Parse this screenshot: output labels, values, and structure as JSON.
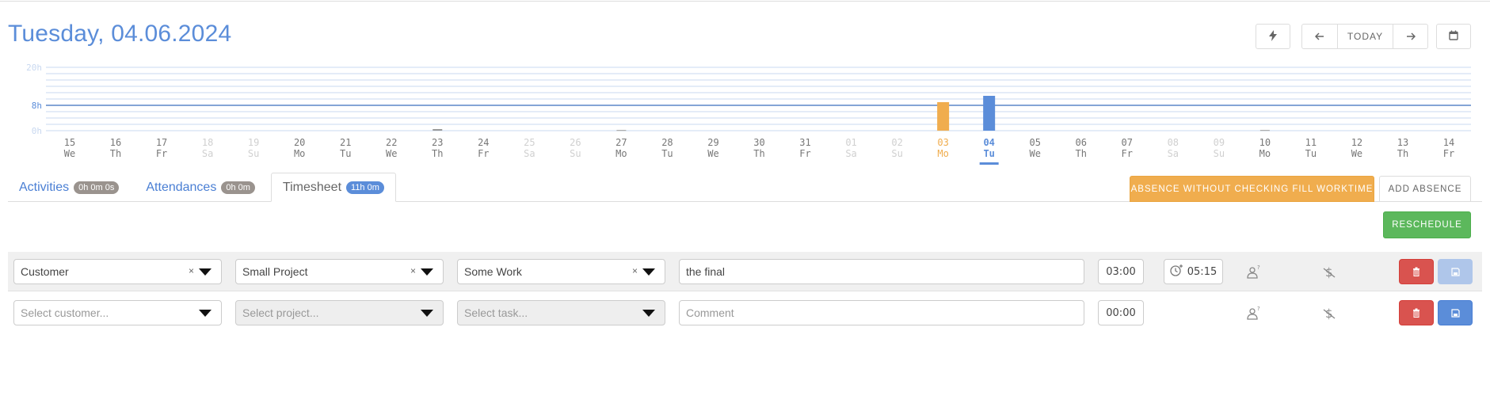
{
  "header": {
    "title": "Tuesday, 04.06.2024",
    "buttons": {
      "quick_icon": "bolt-icon",
      "prev_icon": "arrow-left-icon",
      "today_label": "TODAY",
      "next_icon": "arrow-right-icon",
      "calendar_icon": "calendar-icon"
    }
  },
  "colors": {
    "accent": "#5b8dd9",
    "warning": "#f0ad4e",
    "success": "#5cb85c",
    "danger": "#d9534f",
    "weekend_text": "#d0d0d0",
    "weekday_text": "#777777",
    "grid": "#c9daf0",
    "target_line": "#5b87c9"
  },
  "chart_data": {
    "type": "bar",
    "title": "",
    "ylabel": "",
    "xlabel": "",
    "ylim": [
      0,
      20
    ],
    "y_ticks_labeled": [
      "20h",
      "8h",
      "0h"
    ],
    "gridline_step_hours": 2,
    "target_hours": 8,
    "selected_index": 20,
    "categories": [
      {
        "day": "15",
        "wd": "We",
        "weekend": false
      },
      {
        "day": "16",
        "wd": "Th",
        "weekend": false
      },
      {
        "day": "17",
        "wd": "Fr",
        "weekend": false
      },
      {
        "day": "18",
        "wd": "Sa",
        "weekend": true
      },
      {
        "day": "19",
        "wd": "Su",
        "weekend": true
      },
      {
        "day": "20",
        "wd": "Mo",
        "weekend": false
      },
      {
        "day": "21",
        "wd": "Tu",
        "weekend": false
      },
      {
        "day": "22",
        "wd": "We",
        "weekend": false
      },
      {
        "day": "23",
        "wd": "Th",
        "weekend": false
      },
      {
        "day": "24",
        "wd": "Fr",
        "weekend": false
      },
      {
        "day": "25",
        "wd": "Sa",
        "weekend": true
      },
      {
        "day": "26",
        "wd": "Su",
        "weekend": true
      },
      {
        "day": "27",
        "wd": "Mo",
        "weekend": false
      },
      {
        "day": "28",
        "wd": "Tu",
        "weekend": false
      },
      {
        "day": "29",
        "wd": "We",
        "weekend": false
      },
      {
        "day": "30",
        "wd": "Th",
        "weekend": false
      },
      {
        "day": "31",
        "wd": "Fr",
        "weekend": false
      },
      {
        "day": "01",
        "wd": "Sa",
        "weekend": true
      },
      {
        "day": "02",
        "wd": "Su",
        "weekend": true
      },
      {
        "day": "03",
        "wd": "Mo",
        "weekend": false,
        "highlight": "warning"
      },
      {
        "day": "04",
        "wd": "Tu",
        "weekend": false,
        "highlight": "selected"
      },
      {
        "day": "05",
        "wd": "We",
        "weekend": false
      },
      {
        "day": "06",
        "wd": "Th",
        "weekend": false
      },
      {
        "day": "07",
        "wd": "Fr",
        "weekend": false
      },
      {
        "day": "08",
        "wd": "Sa",
        "weekend": true
      },
      {
        "day": "09",
        "wd": "Su",
        "weekend": true
      },
      {
        "day": "10",
        "wd": "Mo",
        "weekend": false
      },
      {
        "day": "11",
        "wd": "Tu",
        "weekend": false
      },
      {
        "day": "12",
        "wd": "We",
        "weekend": false
      },
      {
        "day": "13",
        "wd": "Th",
        "weekend": false
      },
      {
        "day": "14",
        "wd": "Fr",
        "weekend": false
      }
    ],
    "values": [
      0,
      0,
      0,
      0,
      0,
      0,
      0,
      0,
      0.5,
      0,
      0,
      0,
      0.2,
      0,
      0,
      0,
      0,
      0,
      0,
      9,
      11,
      0,
      0,
      0,
      0,
      0,
      0.2,
      0,
      0,
      0,
      0
    ],
    "bar_colors": {
      "default": "#999999",
      "warning": "#f0ad4e",
      "selected": "#5b8dd9"
    }
  },
  "tabs": [
    {
      "label": "Activities",
      "badge": "0h 0m 0s",
      "active": false
    },
    {
      "label": "Attendances",
      "badge": "0h 0m",
      "active": false
    },
    {
      "label": "Timesheet",
      "badge": "11h 0m",
      "active": true
    }
  ],
  "actions": {
    "absence_fill": "ABSENCE WITHOUT CHECKING FILL WORKTIME",
    "add_absence": "ADD ABSENCE",
    "reschedule": "RESCHEDULE"
  },
  "rows": [
    {
      "customer": "Customer",
      "project": "Small Project",
      "task": "Some Work",
      "comment": "the final",
      "duration": "03:00",
      "start_time": "05:15",
      "user_icon": "user-question-icon",
      "billable_icon": "dollar-slash-icon",
      "delete_icon": "trash-icon",
      "save_icon": "save-icon"
    },
    {
      "customer_placeholder": "Select customer...",
      "project_placeholder": "Select project...",
      "task_placeholder": "Select task...",
      "comment_placeholder": "Comment",
      "duration": "00:00",
      "user_icon": "user-question-icon",
      "billable_icon": "dollar-slash-icon",
      "delete_icon": "trash-icon",
      "save_icon": "save-icon"
    }
  ]
}
